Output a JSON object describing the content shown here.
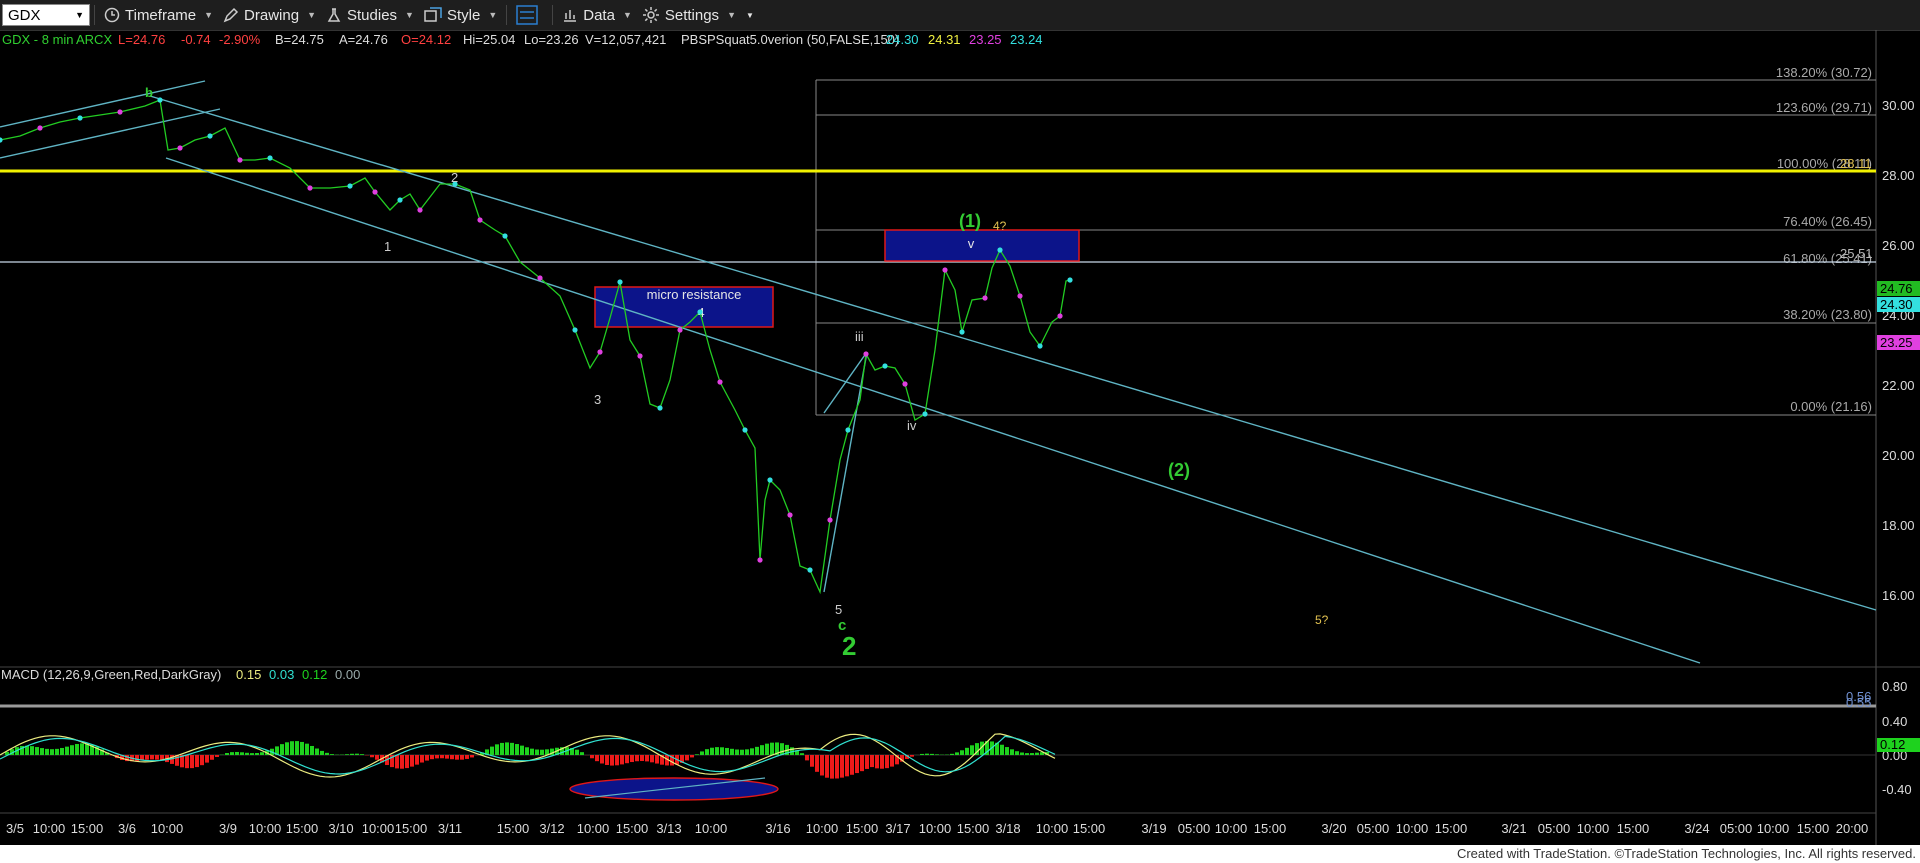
{
  "toolbar": {
    "symbol": "GDX",
    "timeframe": "Timeframe",
    "drawing": "Drawing",
    "studies": "Studies",
    "style": "Style",
    "data": "Data",
    "settings": "Settings"
  },
  "price_header": {
    "symbol": "GDX - 8 min",
    "exchange": "ARCX",
    "last": "L=24.76",
    "change": "-0.74",
    "change_pct": "-2.90%",
    "bid": "B=24.75",
    "ask": "A=24.76",
    "open": "O=24.12",
    "high": "Hi=25.04",
    "low": "Lo=23.26",
    "volume": "V=12,057,421",
    "study": "PBSPSquat5.0verion (50,FALSE,150)",
    "study_values": [
      "24.30",
      "24.31",
      "23.25",
      "23.24"
    ]
  },
  "macd_header": {
    "label": "MACD (12,26,9,Green,Red,DarkGray)",
    "values": [
      "0.15",
      "0.03",
      "0.12",
      "0.00"
    ]
  },
  "price_axis": {
    "ticks": [
      "30.00",
      "28.00",
      "26.00",
      "24.00",
      "22.00",
      "20.00",
      "18.00",
      "16.00"
    ],
    "badges": [
      "24.76",
      "24.30",
      "23.25"
    ],
    "overlaps": [
      "28.11",
      "25.51"
    ]
  },
  "macd_axis": {
    "ticks": [
      "0.80",
      "0.40",
      "0.00",
      "-0.40"
    ],
    "badge": "0.12",
    "overlaps": [
      "0.56",
      "0.55"
    ]
  },
  "time_axis": {
    "labels": [
      "3/5",
      "10:00",
      "15:00",
      "3/6",
      "10:00",
      "3/9",
      "10:00",
      "15:00",
      "3/10",
      "10:00",
      "15:00",
      "3/11",
      "15:00",
      "3/12",
      "10:00",
      "15:00",
      "3/13",
      "10:00",
      "3/16",
      "10:00",
      "15:00",
      "3/17",
      "10:00",
      "15:00",
      "3/18",
      "10:00",
      "15:00",
      "3/19",
      "05:00",
      "10:00",
      "15:00",
      "3/20",
      "05:00",
      "10:00",
      "15:00",
      "3/21",
      "05:00",
      "10:00",
      "15:00",
      "3/24",
      "05:00",
      "10:00",
      "15:00",
      "20:00"
    ]
  },
  "fib_levels": [
    "138.20% (30.72)",
    "123.60% (29.71)",
    "100.00% (28.11)",
    "76.40% (26.45)",
    "61.80% (25.41)",
    "38.20% (23.80)",
    "0.00% (21.16)"
  ],
  "annotations": {
    "micro_resistance": "micro resistance",
    "wave_b": "b",
    "wave_1": "1",
    "wave_2_small": "2",
    "wave_3": "3",
    "wave_4": "4",
    "wave_5": "5",
    "wave_c": "c",
    "wave_2_big": "2",
    "wave_iii": "iii",
    "wave_iv": "iv",
    "wave_v": "v",
    "wave_1_paren": "(1)",
    "wave_4q": "4?",
    "wave_2_paren": "(2)",
    "wave_5q": "5?"
  },
  "footer": {
    "text": "Created with TradeStation. ©TradeStation Technologies, Inc. All rights reserved."
  },
  "colors": {
    "background": "#000000",
    "price_up": "#22cc22",
    "price_down": "#dddddd",
    "dot_cyan": "#33e0e0",
    "dot_magenta": "#e040e0",
    "channel": "#5fb4c4",
    "yellow_line": "#f2f200",
    "box_fill": "#0c148a",
    "box_border": "#e01818",
    "wave_green": "#33cc33",
    "macd_line": "#ecec80",
    "signal_line": "#30e0d0",
    "hist_up": "#1ed21e",
    "hist_down": "#ee1a1a"
  }
}
